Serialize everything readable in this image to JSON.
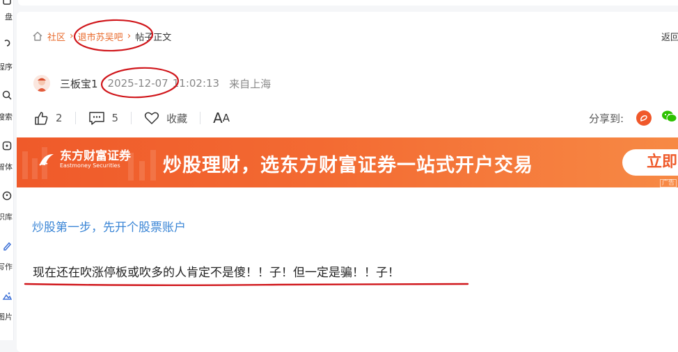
{
  "sidebar": {
    "items": [
      {
        "label": "盘",
        "icon": "disk-icon"
      },
      {
        "label": "程序",
        "icon": "miniprogram-icon"
      },
      {
        "label": "搜索",
        "icon": "search-icon"
      },
      {
        "label": "智体",
        "icon": "agent-icon"
      },
      {
        "label": "识库",
        "icon": "knowledge-base-icon"
      },
      {
        "label": "写作",
        "icon": "pen-icon"
      },
      {
        "label": "图片",
        "icon": "image-icon"
      }
    ]
  },
  "breadcrumb": {
    "home_label": "社区",
    "forum_label": "退市苏吴吧",
    "current_label": "帖子正文",
    "back_label": "返回"
  },
  "post": {
    "author": "三板宝1",
    "date": "2025-12-07",
    "time": "11:02:13",
    "location": "来自上海",
    "likes": "2",
    "comments": "5",
    "favorite_label": "收藏",
    "font_size_label_big": "A",
    "font_size_label_small": "A",
    "share_label": "分享到:",
    "promo_text": "炒股第一步，先开个股票账户",
    "content": "现在还在吹涨停板或吹多的人肯定不是傻！！子！但一定是骗！！子！"
  },
  "banner": {
    "logo_cn": "东方财富证券",
    "logo_en": "Eastmoney Securities",
    "slogan": "炒股理财，选东方财富证券一站式开户交易",
    "cta": "立即",
    "ad_tag": "广告"
  },
  "colors": {
    "accent_orange": "#e8692a",
    "link_blue": "#3b86d6",
    "annotation_red": "#d0161b",
    "banner_orange": "#ef5a2a"
  }
}
